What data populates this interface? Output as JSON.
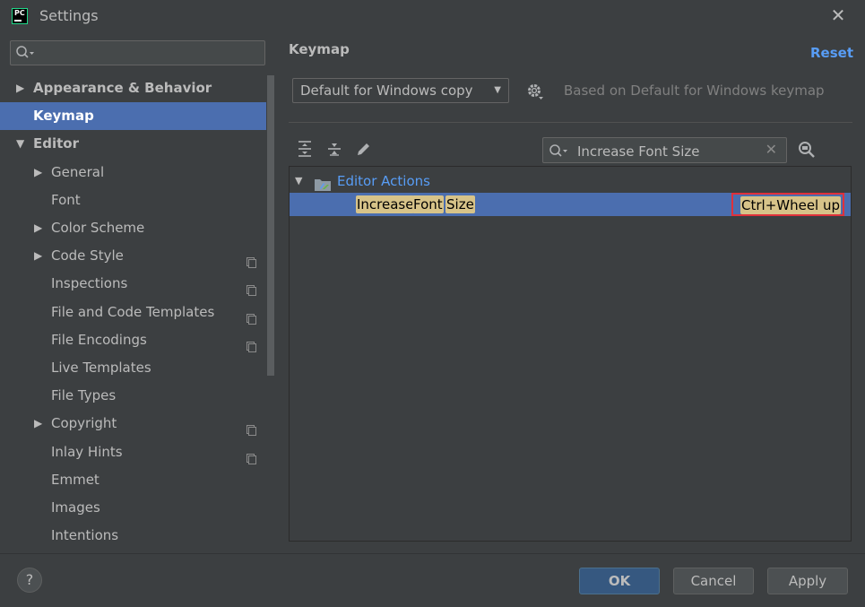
{
  "window": {
    "title": "Settings",
    "app_logo_text": "PC"
  },
  "sidebar": {
    "search": {
      "value": "",
      "placeholder": ""
    },
    "items": [
      {
        "label": "Appearance & Behavior",
        "level": 0,
        "expanded": false,
        "bold": true
      },
      {
        "label": "Keymap",
        "level": 0,
        "bold": true,
        "selected": true
      },
      {
        "label": "Editor",
        "level": 0,
        "expanded": true,
        "bold": true
      },
      {
        "label": "General",
        "level": 1,
        "expandable": true
      },
      {
        "label": "Font",
        "level": 1
      },
      {
        "label": "Color Scheme",
        "level": 1,
        "expandable": true
      },
      {
        "label": "Code Style",
        "level": 1,
        "expandable": true,
        "project_icon": true
      },
      {
        "label": "Inspections",
        "level": 1,
        "project_icon": true
      },
      {
        "label": "File and Code Templates",
        "level": 1,
        "project_icon": true
      },
      {
        "label": "File Encodings",
        "level": 1,
        "project_icon": true
      },
      {
        "label": "Live Templates",
        "level": 1
      },
      {
        "label": "File Types",
        "level": 1
      },
      {
        "label": "Copyright",
        "level": 1,
        "expandable": true,
        "project_icon": true
      },
      {
        "label": "Inlay Hints",
        "level": 1,
        "project_icon": true
      },
      {
        "label": "Emmet",
        "level": 1
      },
      {
        "label": "Images",
        "level": 1
      },
      {
        "label": "Intentions",
        "level": 1
      }
    ]
  },
  "main": {
    "title": "Keymap",
    "reset_label": "Reset",
    "keymap_selected": "Default for Windows copy",
    "based_on": "Based on Default for Windows keymap",
    "filter": {
      "value": "Increase Font Size",
      "placeholder": ""
    },
    "tree": {
      "group_label": "Editor Actions",
      "action_words": [
        "Increase",
        "Font",
        "Size"
      ],
      "shortcut": "Ctrl+Wheel up"
    }
  },
  "footer": {
    "help_label": "?",
    "ok_label": "OK",
    "cancel_label": "Cancel",
    "apply_label": "Apply"
  },
  "colors": {
    "selection": "#4b6eaf",
    "link": "#589df6",
    "highlight": "#d7c389",
    "annotation_border": "#e0313b"
  }
}
